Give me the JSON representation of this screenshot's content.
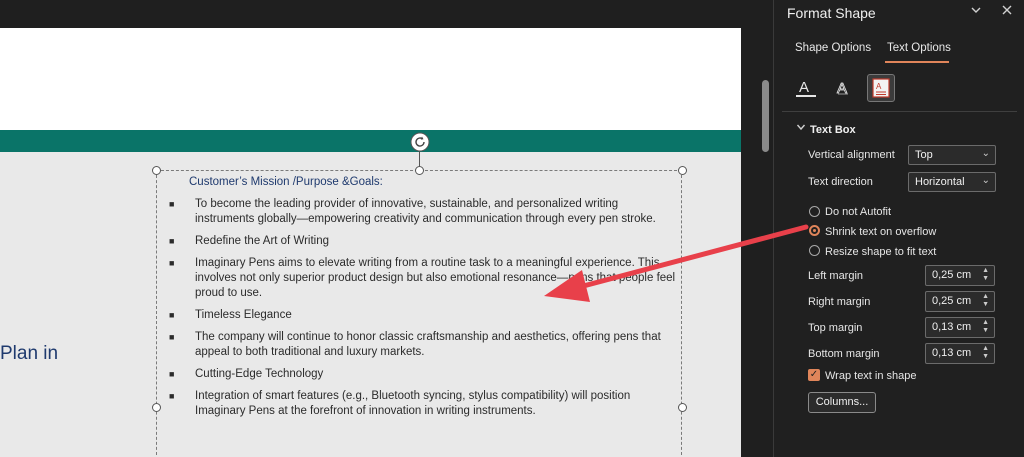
{
  "slide": {
    "left_heading": "Plan in",
    "textbox": {
      "title": "Customer’s Mission /Purpose &Goals:",
      "bullet_glyph": "■",
      "items": [
        "To become the leading provider of innovative, sustainable, and personalized writing instruments globally—empowering creativity and communication through every pen stroke.",
        "Redefine the Art of Writing",
        "Imaginary Pens aims to elevate writing from a routine task to a meaningful experience. This involves not only superior product design but also emotional resonance—pens that people feel proud to use.",
        "Timeless Elegance",
        "The company will continue to honor classic craftsmanship and aesthetics, offering pens that appeal to both traditional and luxury markets.",
        "Cutting-Edge Technology",
        "Integration of smart features (e.g., Bluetooth syncing, stylus compatibility) will position Imaginary Pens at the forefront of innovation in writing instruments."
      ]
    }
  },
  "pane": {
    "title": "Format Shape",
    "tabs": [
      "Shape Options",
      "Text Options"
    ],
    "active_tab": "Text Options",
    "section_title": "Text Box",
    "vertical_alignment": {
      "label": "Vertical alignment",
      "value": "Top"
    },
    "text_direction": {
      "label": "Text direction",
      "value": "Horizontal"
    },
    "autofit_options": [
      {
        "label": "Do not Autofit",
        "selected": false
      },
      {
        "label": "Shrink text on overflow",
        "selected": true
      },
      {
        "label": "Resize shape to fit text",
        "selected": false
      }
    ],
    "margins": [
      {
        "label": "Left margin",
        "value": "0,25 cm"
      },
      {
        "label": "Right margin",
        "value": "0,25 cm"
      },
      {
        "label": "Top margin",
        "value": "0,13 cm"
      },
      {
        "label": "Bottom margin",
        "value": "0,13 cm"
      }
    ],
    "wrap_text": {
      "label": "Wrap text in shape",
      "checked": true
    },
    "columns_button": "Columns..."
  },
  "colors": {
    "accent": "#e0855a",
    "teal_bar": "#0a7468",
    "title_blue": "#1f3a6e",
    "annotation_arrow": "#e8404a"
  }
}
